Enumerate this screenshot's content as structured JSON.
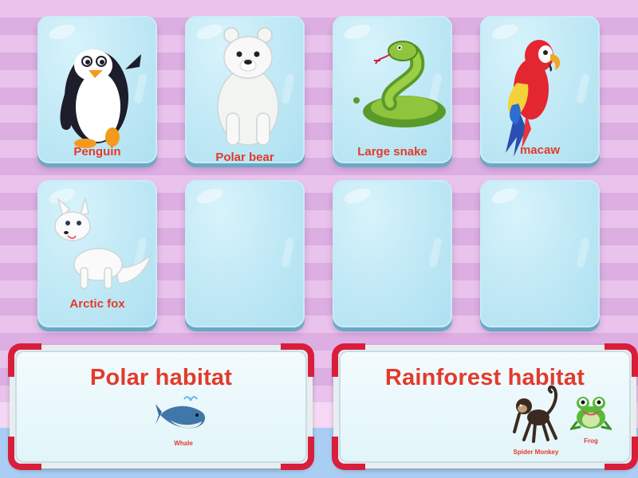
{
  "cards": [
    {
      "label": "Penguin",
      "icon": "penguin-icon"
    },
    {
      "label": "Polar bear",
      "icon": "polar-bear-icon"
    },
    {
      "label": "Large snake",
      "icon": "snake-icon"
    },
    {
      "label": "macaw",
      "icon": "macaw-icon"
    },
    {
      "label": "Arctic fox",
      "icon": "arctic-fox-icon"
    },
    {
      "label": "",
      "icon": ""
    },
    {
      "label": "",
      "icon": ""
    },
    {
      "label": "",
      "icon": ""
    }
  ],
  "habitats": [
    {
      "title": "Polar habitat",
      "items": [
        {
          "label": "Whale",
          "icon": "whale-icon"
        }
      ]
    },
    {
      "title": "Rainforest habitat",
      "items": [
        {
          "label": "Spider Monkey",
          "icon": "spider-monkey-icon"
        },
        {
          "label": "Frog",
          "icon": "frog-icon"
        }
      ]
    }
  ],
  "colors": {
    "label": "#e33a2c",
    "card": "#bfe8f5",
    "frame": "#d81e3b"
  }
}
